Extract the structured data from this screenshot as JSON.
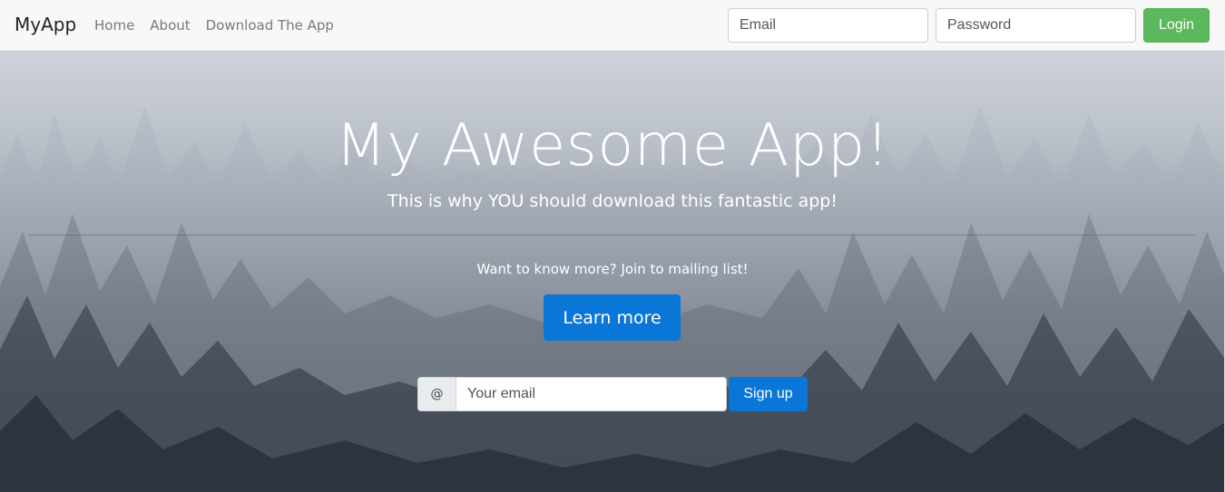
{
  "navbar": {
    "brand": "MyApp",
    "links": [
      {
        "label": "Home"
      },
      {
        "label": "About"
      },
      {
        "label": "Download The App"
      }
    ],
    "email_placeholder": "Email",
    "password_placeholder": "Password",
    "login_label": "Login"
  },
  "hero": {
    "title": "My Awesome App!",
    "subtitle": "This is why YOU should download this fantastic app!",
    "mailing_text": "Want to know more? Join to mailing list!",
    "learn_more_label": "Learn more",
    "signup": {
      "addon": "@",
      "email_placeholder": "Your email",
      "button_label": "Sign up"
    }
  },
  "colors": {
    "login_button": "#5cb85c",
    "primary_button": "#0a76d8",
    "navbar_bg": "#f8f8f8"
  },
  "icons": {
    "signup_addon": "at-symbol"
  }
}
